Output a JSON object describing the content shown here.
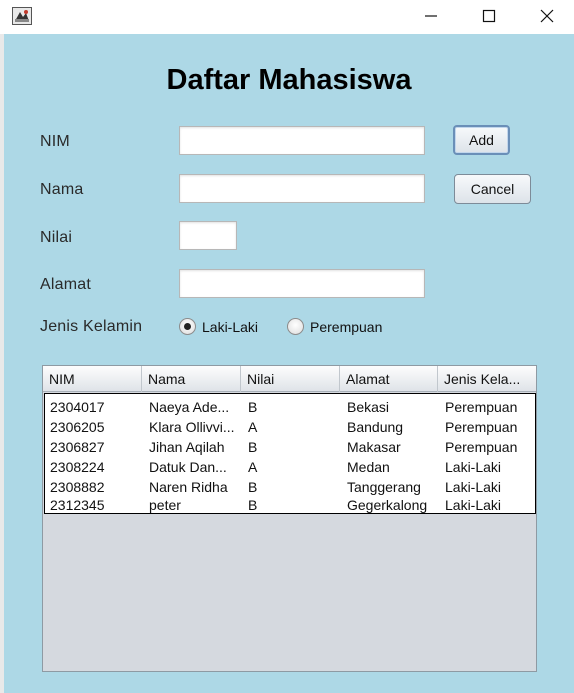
{
  "window": {
    "icons": {
      "app": "java-app-icon",
      "minimize": "minimize-icon",
      "maximize": "maximize-icon",
      "close": "close-icon"
    }
  },
  "form": {
    "title": "Daftar Mahasiswa",
    "nim_label": "NIM",
    "nama_label": "Nama",
    "nilai_label": "Nilai",
    "alamat_label": "Alamat",
    "jenis_kelamin_label": "Jenis Kelamin",
    "nim_value": "",
    "nama_value": "",
    "nilai_value": "",
    "alamat_value": "",
    "add_label": "Add",
    "cancel_label": "Cancel",
    "gender_options": [
      {
        "label": "Laki-Laki",
        "checked": true
      },
      {
        "label": "Perempuan",
        "checked": false
      }
    ]
  },
  "table": {
    "columns": [
      "NIM",
      "Nama",
      "Nilai",
      "Alamat",
      "Jenis Kela..."
    ],
    "rows": [
      [
        "2304017",
        "Naeya Ade...",
        "B",
        "Bekasi",
        "Perempuan"
      ],
      [
        "2306205",
        "Klara Ollivvi...",
        "A",
        "Bandung",
        "Perempuan"
      ],
      [
        "2306827",
        "Jihan Aqilah",
        "B",
        "Makasar",
        "Perempuan"
      ],
      [
        "2308224",
        "Datuk Dan...",
        "A",
        "Medan",
        "Laki-Laki"
      ],
      [
        "2308882",
        "Naren Ridha",
        "B",
        "Tanggerang",
        "Laki-Laki"
      ],
      [
        "2312345",
        "peter",
        "B",
        "Gegerkalong",
        "Laki-Laki"
      ]
    ]
  },
  "colors": {
    "background": "#add8e6",
    "table_empty_area": "#d5d9df"
  }
}
